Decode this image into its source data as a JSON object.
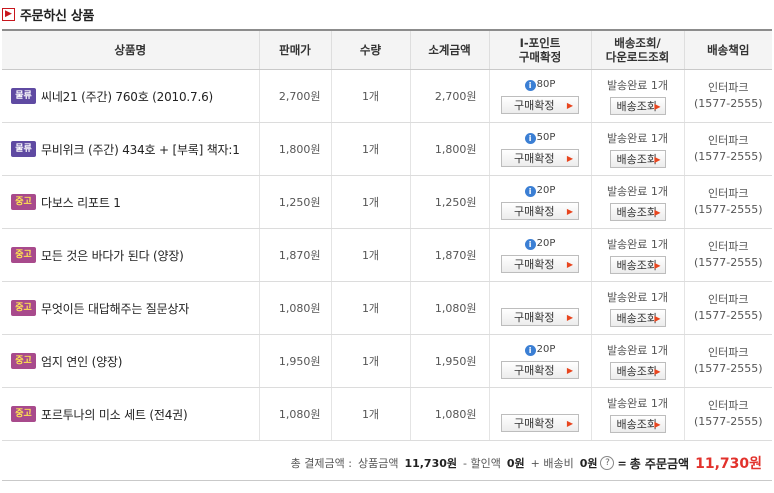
{
  "section": {
    "title": "주문하신 상품",
    "mark": "▶"
  },
  "columns": {
    "name": "상품명",
    "price": "판매가",
    "qty": "수량",
    "subtotal": "소계금액",
    "point_line1": "I-포인트",
    "point_line2": "구매확정",
    "ship_line1": "배송조회/",
    "ship_line2": "다운로드조회",
    "resp": "배송책임"
  },
  "labels": {
    "confirm_button": "구매확정",
    "ship_button": "배송조회",
    "ship_status": "발송완료 1개",
    "resp_name": "인터파크",
    "resp_phone": "(1577-2555)",
    "point_icon": "i"
  },
  "rows": [
    {
      "badge": "물류",
      "badge_type": "logi",
      "name": "씨네21 (주간) 760호 (2010.7.6)",
      "price": "2,700원",
      "qty": "1개",
      "subtotal": "2,700원",
      "point": "80P"
    },
    {
      "badge": "물류",
      "badge_type": "logi",
      "name": "무비위크 (주간) 434호 + [부록] 책자:1",
      "price": "1,800원",
      "qty": "1개",
      "subtotal": "1,800원",
      "point": "50P"
    },
    {
      "badge": "중고",
      "badge_type": "used",
      "name": "다보스 리포트 1",
      "price": "1,250원",
      "qty": "1개",
      "subtotal": "1,250원",
      "point": "20P"
    },
    {
      "badge": "중고",
      "badge_type": "used",
      "name": "모든 것은 바다가 된다 (양장)",
      "price": "1,870원",
      "qty": "1개",
      "subtotal": "1,870원",
      "point": "20P"
    },
    {
      "badge": "중고",
      "badge_type": "used",
      "name": "무엇이든 대답해주는 질문상자",
      "price": "1,080원",
      "qty": "1개",
      "subtotal": "1,080원",
      "point": ""
    },
    {
      "badge": "중고",
      "badge_type": "used",
      "name": "엄지 연인 (양장)",
      "price": "1,950원",
      "qty": "1개",
      "subtotal": "1,950원",
      "point": "20P"
    },
    {
      "badge": "중고",
      "badge_type": "used",
      "name": "포르투나의 미소 세트 (전4권)",
      "price": "1,080원",
      "qty": "1개",
      "subtotal": "1,080원",
      "point": ""
    }
  ],
  "summary": {
    "label": "총 결제금액 :",
    "goods_label": "상품금액",
    "goods_value": "11,730원",
    "discount_label": "- 할인액",
    "discount_value": "0원",
    "shipping_label": "+ 배송비",
    "shipping_value": "0원",
    "help": "?",
    "equals": "=",
    "grand_label": "총 주문금액",
    "grand_value": "11,730원"
  },
  "colors": {
    "accent_red": "#e2322c",
    "badge_logi": "#5f4aa2",
    "badge_used": "#a84a8c",
    "point_blue": "#3b7fd4"
  }
}
